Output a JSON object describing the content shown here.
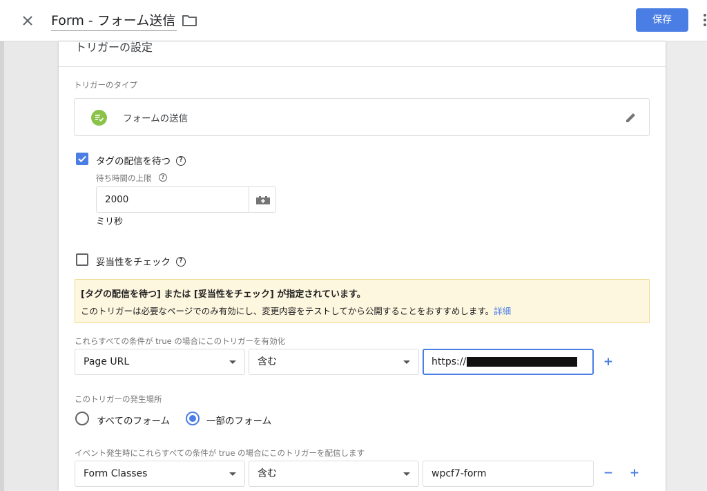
{
  "header": {
    "title": "Form - フォーム送信",
    "save_label": "保存"
  },
  "card": {
    "section_title": "トリガーの設定",
    "trigger_type_label": "トリガーのタイプ",
    "trigger_type_name": "フォームの送信",
    "wait_for_tags": {
      "label": "タグの配信を待つ",
      "checked": true,
      "max_wait_label": "待ち時間の上限",
      "max_wait_value": "2000",
      "unit": "ミリ秒"
    },
    "check_validation": {
      "label": "妥当性をチェック",
      "checked": false
    },
    "notice": {
      "title": "[タグの配信を待つ] または [妥当性をチェック] が指定されています。",
      "body": "このトリガーは必要なページでのみ有効にし、変更内容をテストしてから公開することをおすすめします。",
      "link": "詳細",
      "background_color": "#fef7e0"
    },
    "enable_conditions": {
      "label": "これらすべての条件が true の場合にこのトリガーを有効化",
      "variable": "Page URL",
      "operator": "含む",
      "value_prefix": "https://",
      "value_redacted": true
    },
    "fires_on": {
      "label": "このトリガーの発生場所",
      "options": [
        "すべてのフォーム",
        "一部のフォーム"
      ],
      "selected": "一部のフォーム"
    },
    "fire_conditions": {
      "label": "イベント発生時にこれらすべての条件が true の場合にこのトリガーを配信します",
      "variable": "Form Classes",
      "operator": "含む",
      "value": "wpcf7-form"
    }
  },
  "icons": {
    "close": "close-icon",
    "folder": "folder-icon",
    "more": "more-vert-icon",
    "trigger_type": "form-submit-icon",
    "edit": "pencil-icon",
    "help": "help-icon",
    "variable": "variable-picker-icon"
  },
  "colors": {
    "accent": "#4a7ee4",
    "trigger_icon": "#8bc34a",
    "notice_border": "#f0d98c"
  }
}
